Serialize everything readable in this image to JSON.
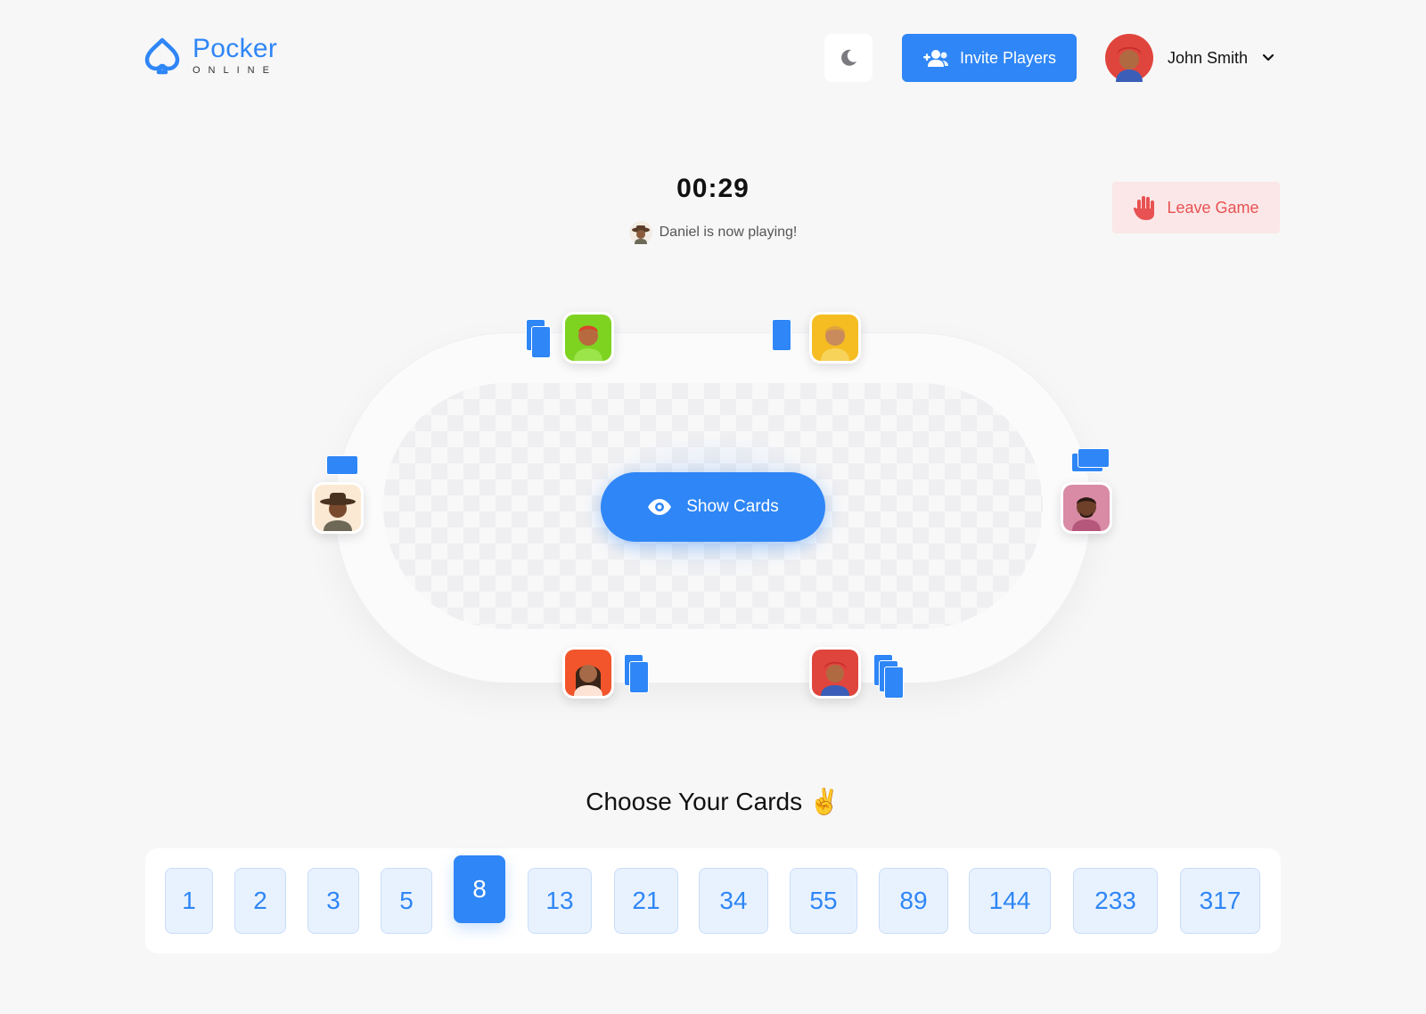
{
  "brand": {
    "title": "Pocker",
    "subtitle": "ONLINE"
  },
  "header": {
    "invite_label": "Invite Players",
    "user_name": "John Smith"
  },
  "game": {
    "timer": "00:29",
    "status": "Daniel is now playing!",
    "leave_label": "Leave Game",
    "show_cards_label": "Show Cards"
  },
  "chooser": {
    "title": "Choose Your Cards ✌️",
    "cards": [
      "1",
      "2",
      "3",
      "5",
      "8",
      "13",
      "21",
      "34",
      "55",
      "89",
      "144",
      "233",
      "317"
    ],
    "selected": "8"
  },
  "colors": {
    "accent": "#2f86f6",
    "danger": "#e85252",
    "danger_bg": "#fbe7e7",
    "card_bg": "#e8f2fe"
  }
}
